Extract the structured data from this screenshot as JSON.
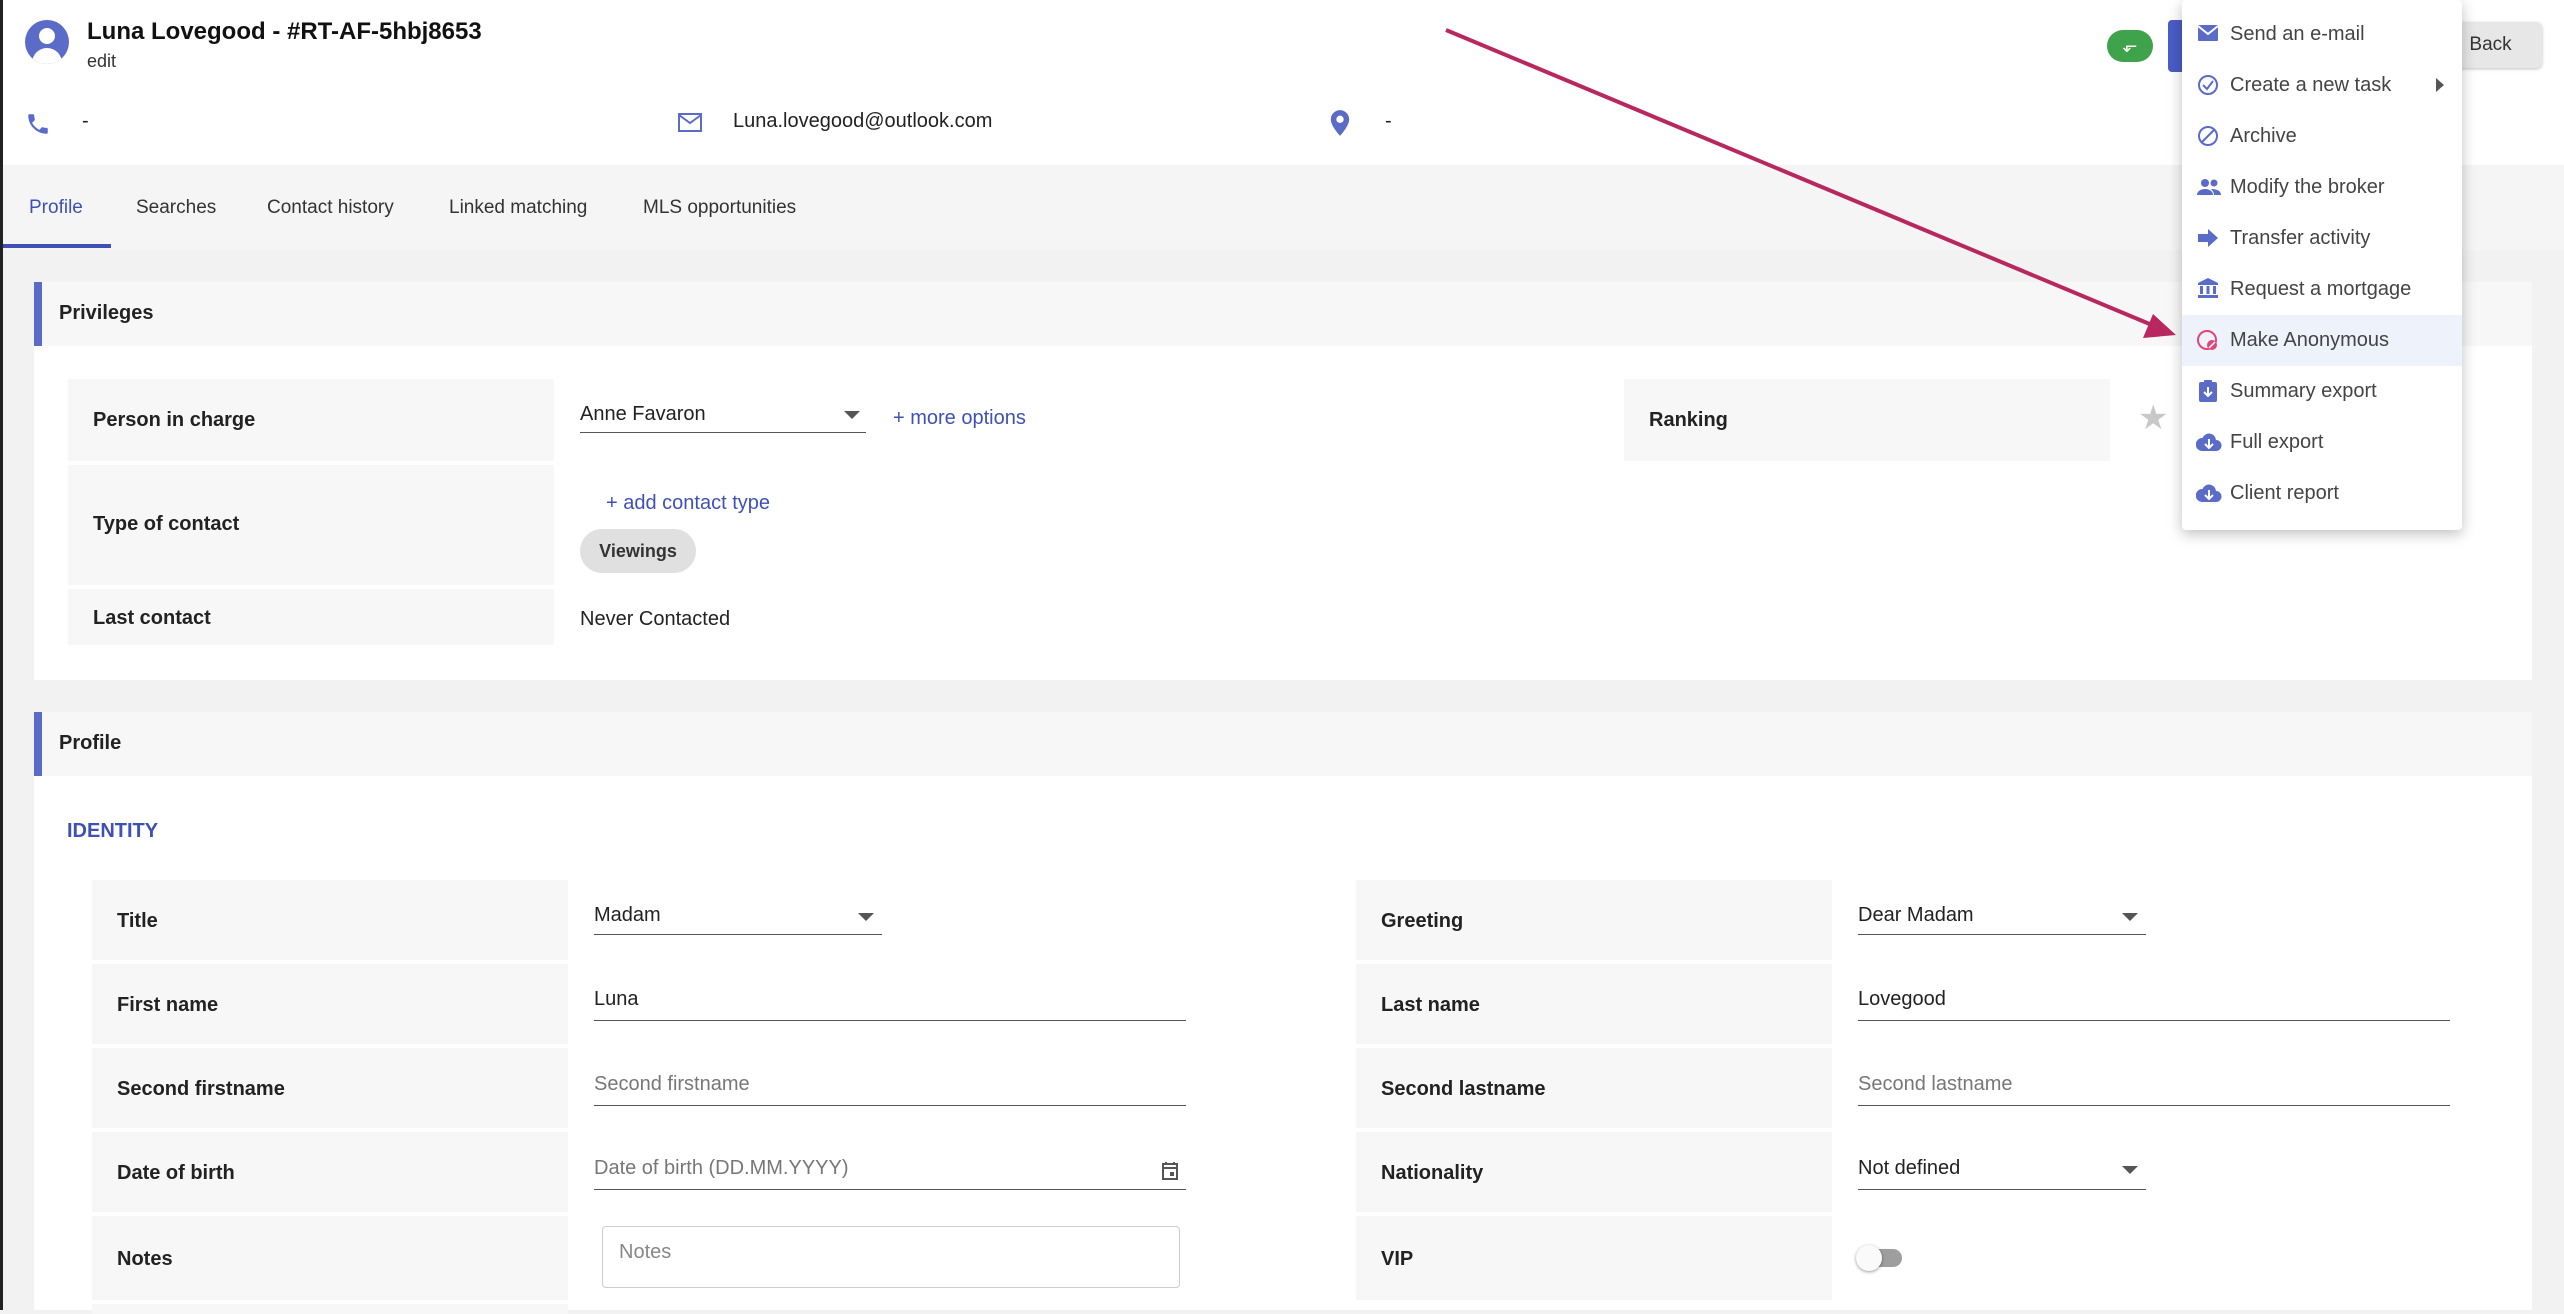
{
  "header": {
    "title": "Luna Lovegood - #RT-AF-5hbj8653",
    "subtitle": "edit",
    "phone": "-",
    "email": "Luna.lovegood@outlook.com",
    "location": "-",
    "back_label": "Back",
    "status_icon": "⬐"
  },
  "tabs": [
    "Profile",
    "Searches",
    "Contact history",
    "Linked matching",
    "MLS opportunities"
  ],
  "privileges": {
    "section_title": "Privileges",
    "person_in_charge_label": "Person in charge",
    "person_in_charge_value": "Anne Favaron",
    "more_options": "+ more options",
    "ranking_label": "Ranking",
    "type_of_contact_label": "Type of contact",
    "add_contact_type": "+ add contact type",
    "contact_type_chip": "Viewings",
    "last_contact_label": "Last contact",
    "last_contact_value": "Never Contacted"
  },
  "profile": {
    "section_title": "Profile",
    "identity_heading": "IDENTITY",
    "title_label": "Title",
    "title_value": "Madam",
    "greeting_label": "Greeting",
    "greeting_value": "Dear Madam",
    "first_name_label": "First name",
    "first_name_value": "Luna",
    "last_name_label": "Last name",
    "last_name_value": "Lovegood",
    "second_firstname_label": "Second firstname",
    "second_firstname_placeholder": "Second firstname",
    "second_lastname_label": "Second lastname",
    "second_lastname_placeholder": "Second lastname",
    "dob_label": "Date of birth",
    "dob_placeholder": "Date of birth (DD.MM.YYYY)",
    "nationality_label": "Nationality",
    "nationality_value": "Not defined",
    "notes_label": "Notes",
    "notes_placeholder": "Notes",
    "vip_label": "VIP",
    "vip_on": false
  },
  "menu": {
    "items": [
      {
        "label": "Send an e-mail",
        "icon": "envelope-icon"
      },
      {
        "label": "Create a new task",
        "icon": "check-circle-icon",
        "submenu": true
      },
      {
        "label": "Archive",
        "icon": "block-icon"
      },
      {
        "label": "Modify the broker",
        "icon": "people-icon"
      },
      {
        "label": "Transfer activity",
        "icon": "arrow-right-icon"
      },
      {
        "label": "Request a mortgage",
        "icon": "bank-icon"
      },
      {
        "label": "Make Anonymous",
        "icon": "anonymous-icon",
        "highlighted": true
      },
      {
        "label": "Summary export",
        "icon": "clipboard-download-icon"
      },
      {
        "label": "Full export",
        "icon": "cloud-download-icon"
      },
      {
        "label": "Client report",
        "icon": "cloud-download-icon"
      }
    ]
  },
  "colors": {
    "accent": "#3f51b5",
    "annotation_arrow": "#b8285e",
    "status_green": "#3ea34a"
  }
}
